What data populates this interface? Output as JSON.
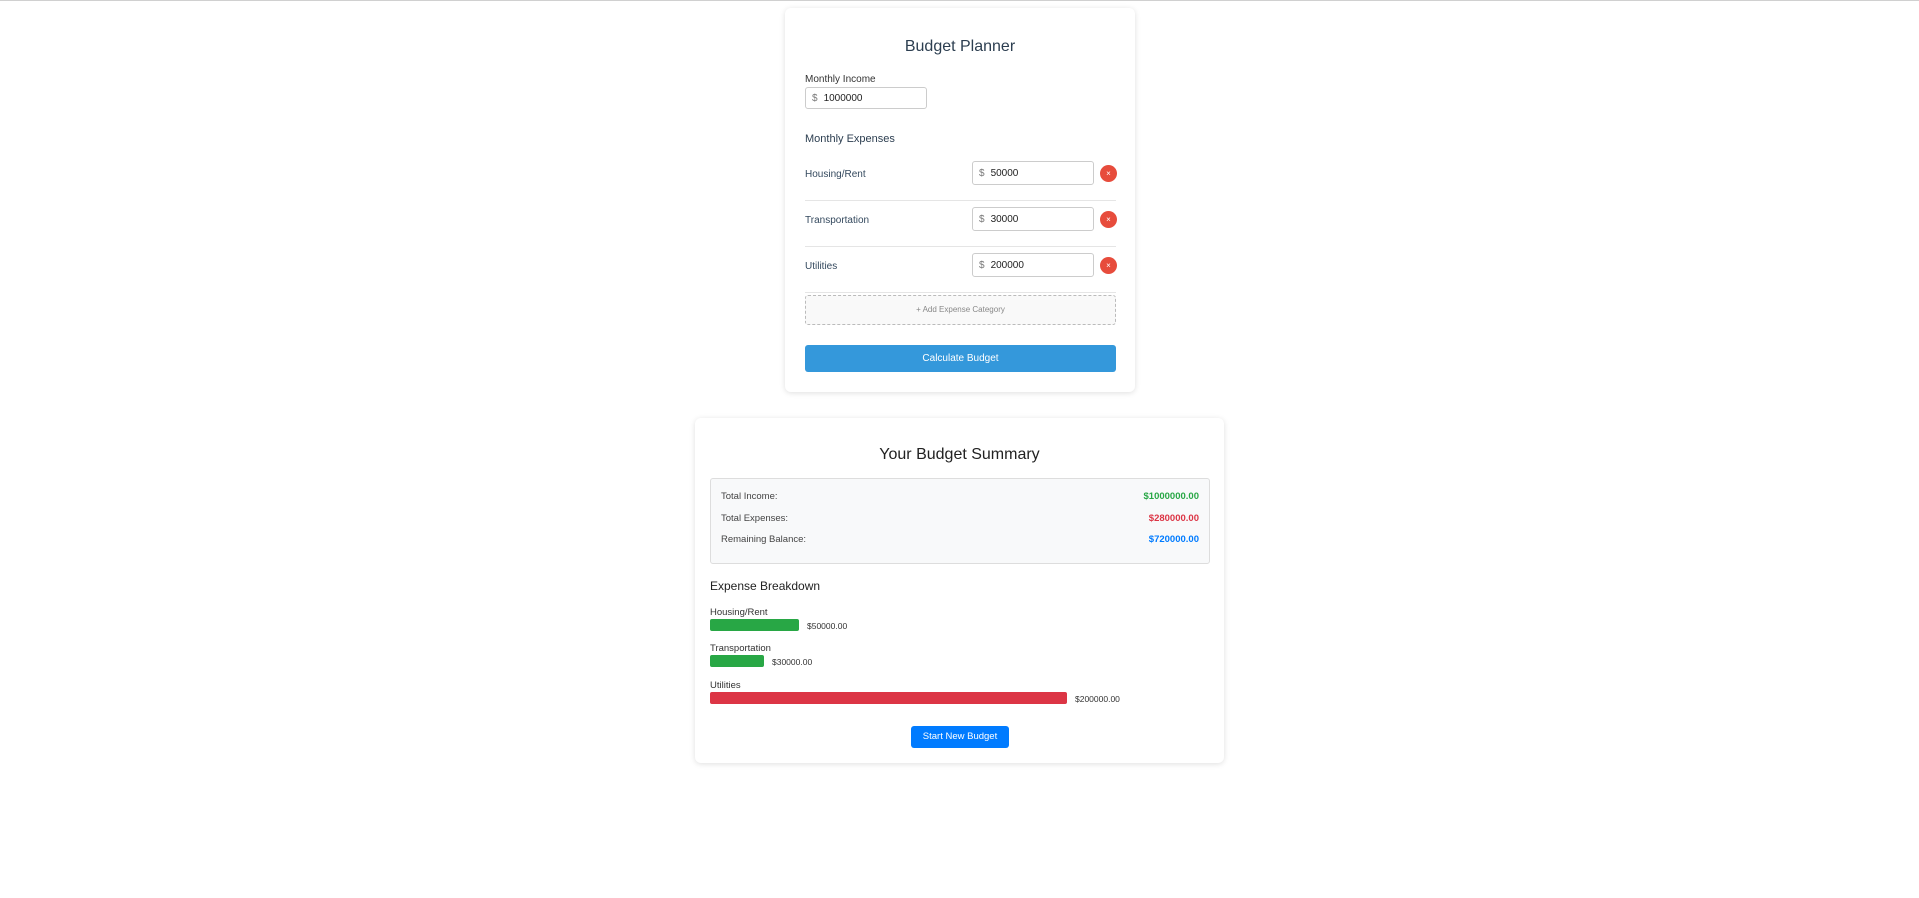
{
  "planner": {
    "title": "Budget Planner",
    "income_label": "Monthly Income",
    "currency_symbol": "$",
    "income_value": "1000000",
    "expenses_heading": "Monthly Expenses",
    "expenses": [
      {
        "name": "Housing/Rent",
        "value": "50000"
      },
      {
        "name": "Transportation",
        "value": "30000"
      },
      {
        "name": "Utilities",
        "value": "200000"
      }
    ],
    "remove_glyph": "×",
    "add_category_label": "+ Add Expense Category",
    "calculate_label": "Calculate Budget"
  },
  "summary": {
    "title": "Your Budget Summary",
    "totals": [
      {
        "label": "Total Income:",
        "amount": "$1000000.00",
        "color": "#28a745"
      },
      {
        "label": "Total Expenses:",
        "amount": "$280000.00",
        "color": "#dc3545"
      },
      {
        "label": "Remaining Balance:",
        "amount": "$720000.00",
        "color": "#007bff"
      }
    ],
    "breakdown_heading": "Expense Breakdown",
    "breakdown": [
      {
        "name": "Housing/Rent",
        "amount": "$50000.00",
        "value": 50000,
        "color": "#28a745"
      },
      {
        "name": "Transportation",
        "amount": "$30000.00",
        "value": 30000,
        "color": "#28a745"
      },
      {
        "name": "Utilities",
        "amount": "$200000.00",
        "value": 200000,
        "color": "#dc3545"
      }
    ],
    "new_budget_label": "Start New Budget"
  },
  "colors": {
    "primary_blue": "#3498db",
    "button_blue": "#007bff",
    "remove_red": "#e74c3c",
    "income_green": "#28a745",
    "expense_red": "#dc3545"
  },
  "icons": {
    "remove": "close-icon",
    "add": "plus-icon"
  }
}
